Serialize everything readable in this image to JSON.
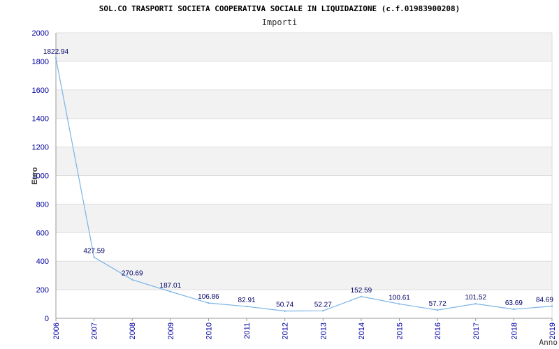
{
  "title": "SOL.CO TRASPORTI SOCIETA COOPERATIVA SOCIALE IN LIQUIDAZIONE (c.f.01983900208)",
  "subtitle": "Importi",
  "chart_data": {
    "type": "line",
    "title": "SOL.CO TRASPORTI SOCIETA COOPERATIVA SOCIALE IN LIQUIDAZIONE (c.f.01983900208)",
    "subtitle": "Importi",
    "xlabel": "Anno",
    "ylabel": "Euro",
    "ylim": [
      0,
      2000
    ],
    "yticks": [
      0,
      200,
      400,
      600,
      800,
      1000,
      1200,
      1400,
      1600,
      1800,
      2000
    ],
    "categories": [
      "2006",
      "2007",
      "2008",
      "2009",
      "2010",
      "2011",
      "2012",
      "2013",
      "2014",
      "2015",
      "2016",
      "2017",
      "2018",
      "2019"
    ],
    "values": [
      1822.94,
      427.59,
      270.69,
      187.01,
      106.86,
      82.91,
      50.74,
      52.27,
      152.59,
      100.61,
      57.72,
      101.52,
      63.69,
      84.69
    ],
    "data_labels": [
      "1822.94",
      "427.59",
      "270.69",
      "187.01",
      "106.86",
      "82.91",
      "50.74",
      "52.27",
      "152.59",
      "100.61",
      "57.72",
      "101.52",
      "63.69",
      "84.69"
    ],
    "grid": true,
    "colors": {
      "line": "#7ab4e6",
      "band": "#f2f2f2",
      "gridline": "#dddddd",
      "axis": "#999999",
      "tick_text": "#0000a0"
    }
  }
}
